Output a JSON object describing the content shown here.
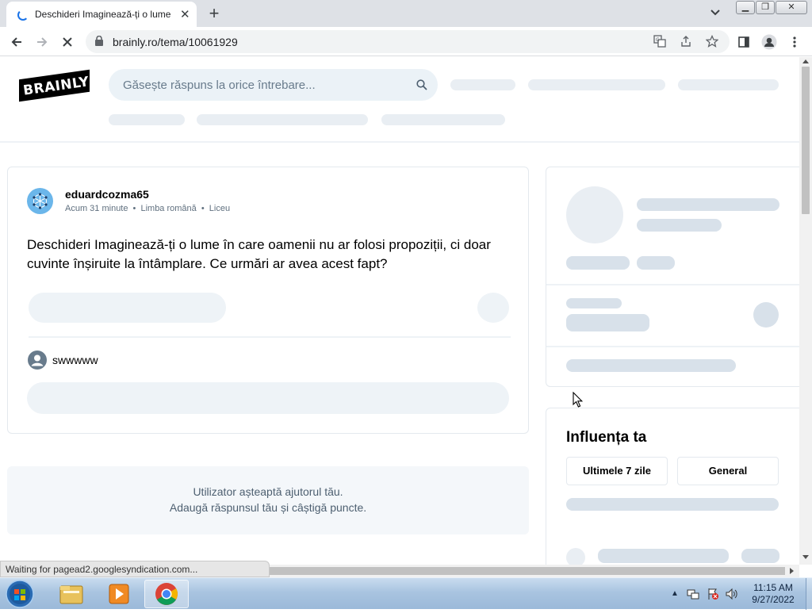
{
  "browser": {
    "tab_title": "Deschideri Imaginează-ți o lume",
    "tab_close": "✕",
    "new_tab": "+",
    "url": "brainly.ro/tema/10061929",
    "status_text": "Waiting for pagead2.googlesyndication.com..."
  },
  "site": {
    "logo_text": "BRAINLY",
    "search_placeholder": "Găsește răspuns la orice întrebare..."
  },
  "question": {
    "author": "eduardcozma65",
    "time": "Acum 31 minute",
    "subject": "Limba română",
    "level": "Liceu",
    "text": "Deschideri Imaginează-ți o lume în care oamenii nu ar folosi propoziții, ci doar cuvinte înșiruite la întâmplare. Ce urmări ar avea acest fapt?",
    "comment_user": "swwwww"
  },
  "answer_prompt": {
    "line1": "Utilizator așteaptă ajutorul tău.",
    "line2": "Adaugă răspunsul tău și câștigă puncte."
  },
  "influence": {
    "title": "Influența ta",
    "tab_week": "Ultimele 7 zile",
    "tab_general": "General"
  },
  "taskbar": {
    "time": "11:15 AM",
    "date": "9/27/2022"
  }
}
